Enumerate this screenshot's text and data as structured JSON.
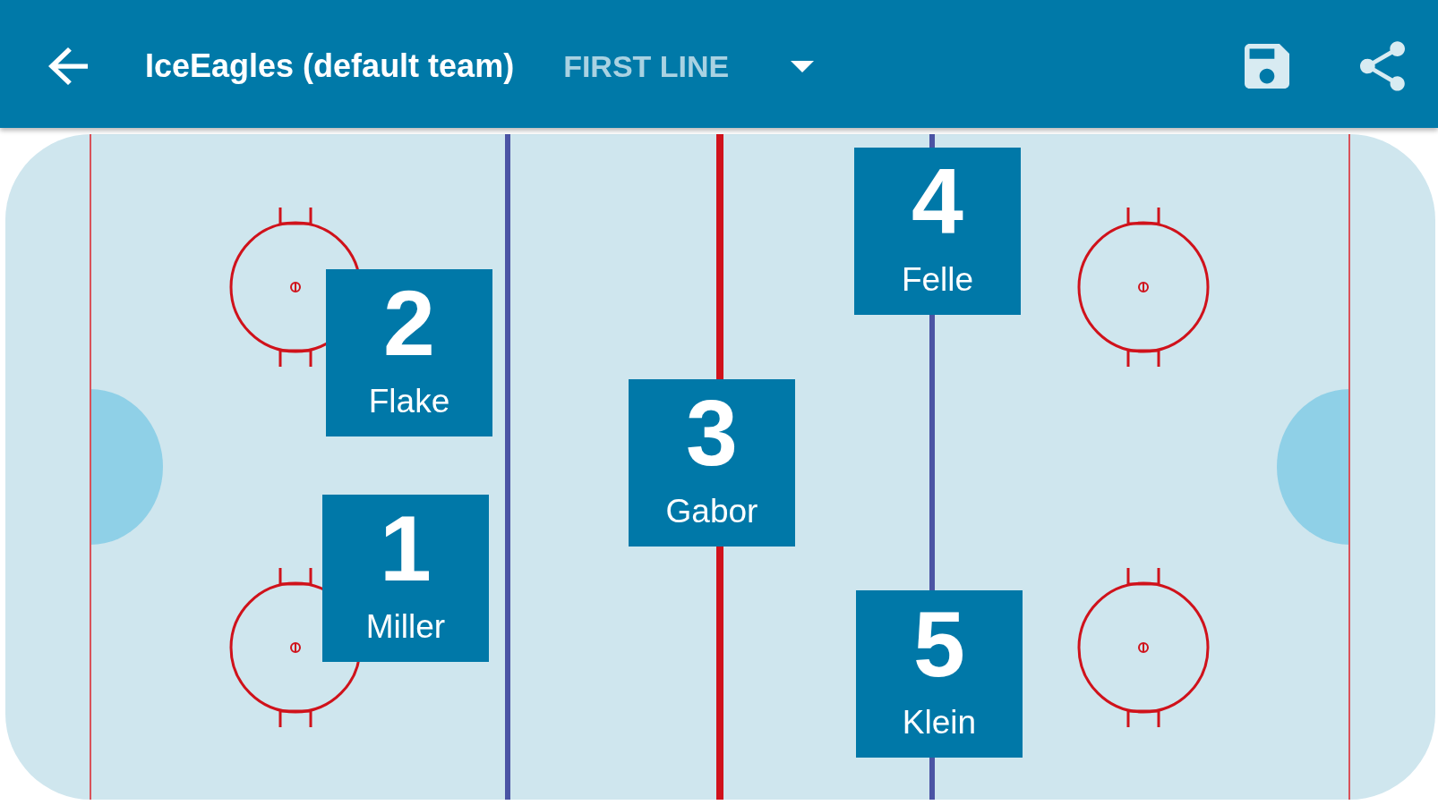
{
  "toolbar": {
    "title": "IceEagles (default team)",
    "line_selector": {
      "value": "FIRST LINE"
    }
  },
  "rink": {
    "players": [
      {
        "number": "2",
        "name": "Flake"
      },
      {
        "number": "1",
        "name": "Miller"
      },
      {
        "number": "3",
        "name": "Gabor"
      },
      {
        "number": "4",
        "name": "Felle"
      },
      {
        "number": "5",
        "name": "Klein"
      }
    ]
  }
}
